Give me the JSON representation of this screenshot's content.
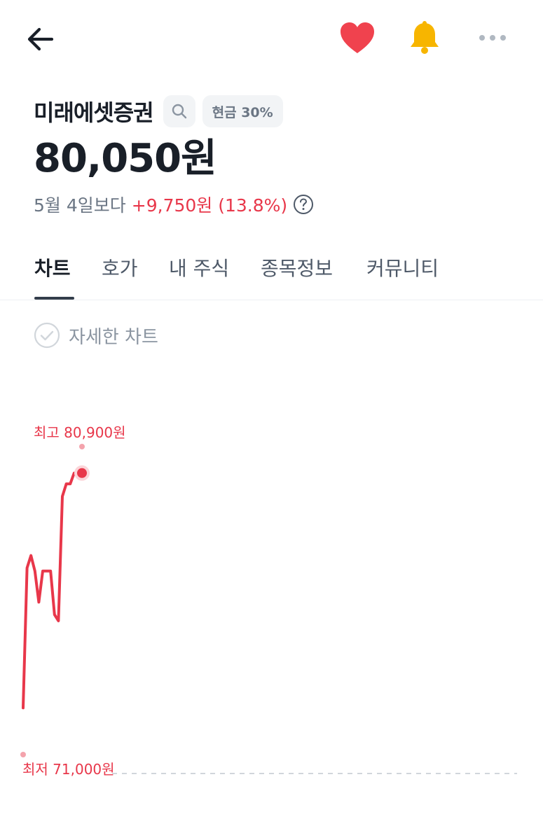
{
  "header": {
    "actions": {
      "back": "back-arrow-icon",
      "favorite": "heart-icon",
      "alert": "bell-icon",
      "more": "more-dots-icon"
    }
  },
  "stock": {
    "name": "미래에셋증권",
    "cash_badge": "현금 30%",
    "price": "80,050원",
    "change_label": "5월 4일보다",
    "change_value": "+9,750원 (13.8%)"
  },
  "tabs": [
    {
      "label": "차트",
      "active": true
    },
    {
      "label": "호가",
      "active": false
    },
    {
      "label": "내 주식",
      "active": false
    },
    {
      "label": "종목정보",
      "active": false
    },
    {
      "label": "커뮤니티",
      "active": false
    }
  ],
  "detail_chart_label": "자세한 차트",
  "colors": {
    "accent_red": "#e8374a",
    "text_primary": "#191f28",
    "text_secondary": "#6b7684",
    "chip_bg": "#f2f4f6",
    "heart": "#f0424e",
    "bell": "#f7b500"
  },
  "chart_data": {
    "type": "line",
    "high_label": "최고 80,900원",
    "low_label": "최저 71,000원",
    "high": 80900,
    "low": 71000,
    "x": [
      0,
      1,
      2,
      3,
      4,
      5,
      6,
      7,
      8,
      9,
      10,
      11,
      12,
      13,
      14,
      15
    ],
    "values": [
      72500,
      77000,
      77400,
      76900,
      75900,
      76900,
      76900,
      76900,
      75500,
      75300,
      79300,
      79700,
      79700,
      80050,
      80050,
      80050
    ],
    "current": 80050
  }
}
